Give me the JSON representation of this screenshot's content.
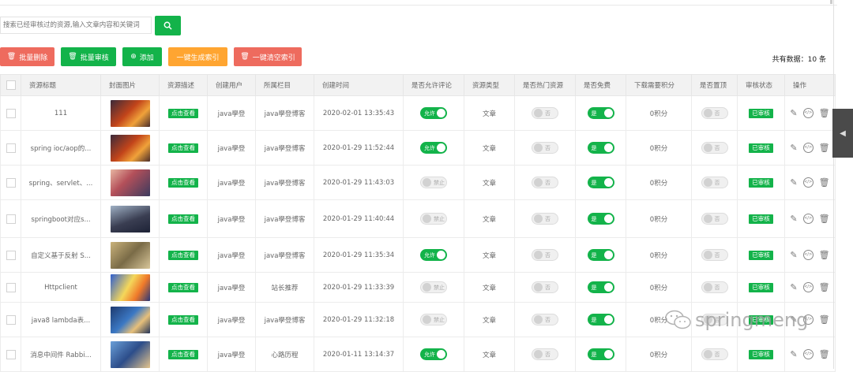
{
  "search": {
    "placeholder": "搜索已经审核过的资源,输入文章内容和关键词"
  },
  "toolbar": {
    "batch_delete": "批量删除",
    "batch_review": "批量审核",
    "add": "添加",
    "gen_index": "一键生成索引",
    "clear_index": "一键清空索引",
    "total_label": "共有数据：10 条"
  },
  "colors": {
    "accent": "#13b34a",
    "danger": "#ee6b5e",
    "warning": "#ffa531"
  },
  "table": {
    "headers": [
      "资源标题",
      "封面图片",
      "资源描述",
      "创建用户",
      "所属栏目",
      "创建时间",
      "是否允许评论",
      "资源类型",
      "是否热门资源",
      "是否免费",
      "下载需要积分",
      "是否置顶",
      "审核状态",
      "操作"
    ],
    "rows": [
      {
        "title": "111",
        "desc": "点击查看",
        "user": "java學登",
        "category": "java學登博客",
        "time": "2020-02-01 13:35:43",
        "comment": "允许",
        "comment_on": true,
        "type": "文章",
        "hot": "否",
        "free": "是",
        "points": "0积分",
        "top": "否",
        "status": "已审核",
        "img": "fire"
      },
      {
        "title": "spring ioc/aop的...",
        "desc": "点击查看",
        "user": "java學登",
        "category": "java學登博客",
        "time": "2020-01-29 11:52:44",
        "comment": "允许",
        "comment_on": true,
        "type": "文章",
        "hot": "否",
        "free": "是",
        "points": "0积分",
        "top": "否",
        "status": "已审核",
        "img": "fire"
      },
      {
        "title": "spring、servlet、...",
        "desc": "点击查看",
        "user": "java學登",
        "category": "java學登博客",
        "time": "2020-01-29 11:43:03",
        "comment": "禁止",
        "comment_on": false,
        "type": "文章",
        "hot": "否",
        "free": "是",
        "points": "0积分",
        "top": "否",
        "status": "已审核",
        "img": "anime"
      },
      {
        "title": "springboot对应s...",
        "desc": "点击查看",
        "user": "java學登",
        "category": "java學登博客",
        "time": "2020-01-29 11:40:44",
        "comment": "禁止",
        "comment_on": false,
        "type": "文章",
        "hot": "否",
        "free": "是",
        "points": "0积分",
        "top": "否",
        "status": "已审核",
        "img": "dark"
      },
      {
        "title": "自定义基于反射 S...",
        "desc": "点击查看",
        "user": "java學登",
        "category": "java學登博客",
        "time": "2020-01-29 11:35:34",
        "comment": "允许",
        "comment_on": true,
        "type": "文章",
        "hot": "否",
        "free": "是",
        "points": "0积分",
        "top": "否",
        "status": "已审核",
        "img": "sand"
      },
      {
        "title": "Httpclient",
        "desc": "点击查看",
        "user": "java學登",
        "category": "站长推荐",
        "time": "2020-01-29 11:33:39",
        "comment": "禁止",
        "comment_on": false,
        "type": "文章",
        "hot": "否",
        "free": "是",
        "points": "0积分",
        "top": "否",
        "status": "已审核",
        "img": "bright"
      },
      {
        "title": "java8 lambda表...",
        "desc": "点击查看",
        "user": "java學登",
        "category": "java學登博客",
        "time": "2020-01-29 11:32:18",
        "comment": "禁止",
        "comment_on": false,
        "type": "文章",
        "hot": "否",
        "free": "是",
        "points": "0积分",
        "top": "否",
        "status": "已审核",
        "img": "blue"
      },
      {
        "title": "消息中间件 Rabbi...",
        "desc": "点击查看",
        "user": "java學登",
        "category": "心路历程",
        "time": "2020-01-11 13:14:37",
        "comment": "允许",
        "comment_on": true,
        "type": "文章",
        "hot": "否",
        "free": "是",
        "points": "0积分",
        "top": "否",
        "status": "已审核",
        "img": "sky"
      }
    ]
  },
  "watermark": "springmeng"
}
